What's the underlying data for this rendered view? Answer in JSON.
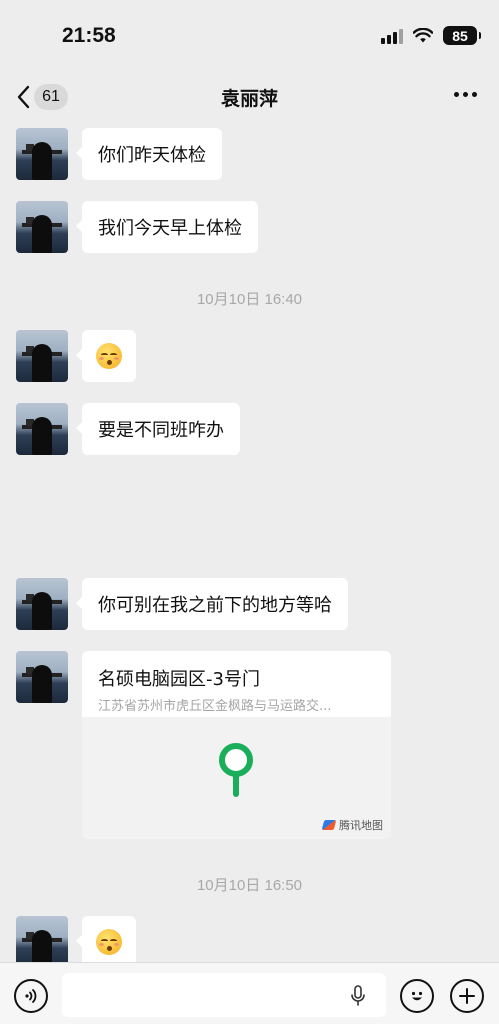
{
  "status_bar": {
    "time": "21:58",
    "battery": "85"
  },
  "nav": {
    "back_count": "61",
    "title": "袁丽萍"
  },
  "messages": [
    {
      "type": "text",
      "text": "你们昨天体检"
    },
    {
      "type": "text",
      "text": "我们今天早上体检"
    },
    {
      "type": "time",
      "text": "10月10日 16:40"
    },
    {
      "type": "emoji",
      "icon": "flushed-face-emoji"
    },
    {
      "type": "text",
      "text": "要是不同班咋办"
    },
    {
      "type": "text",
      "text": "你可别在我之前下的地方等哈"
    },
    {
      "type": "location",
      "title": "名硕电脑园区-3号门",
      "address": "江苏省苏州市虎丘区金枫路与马运路交...",
      "map_brand": "腾讯地图",
      "pin_color": "#1aad5a"
    },
    {
      "type": "time",
      "text": "10月10日 16:50"
    },
    {
      "type": "emoji",
      "icon": "flushed-face-emoji"
    }
  ],
  "input_bar": {
    "placeholder": "",
    "icons": [
      "voice-icon",
      "microphone-icon",
      "emoji-icon",
      "plus-icon"
    ]
  },
  "colors": {
    "background": "#ededed",
    "bubble": "#ffffff",
    "timestamp": "#a8a8a8",
    "accent_green": "#1aad5a"
  }
}
